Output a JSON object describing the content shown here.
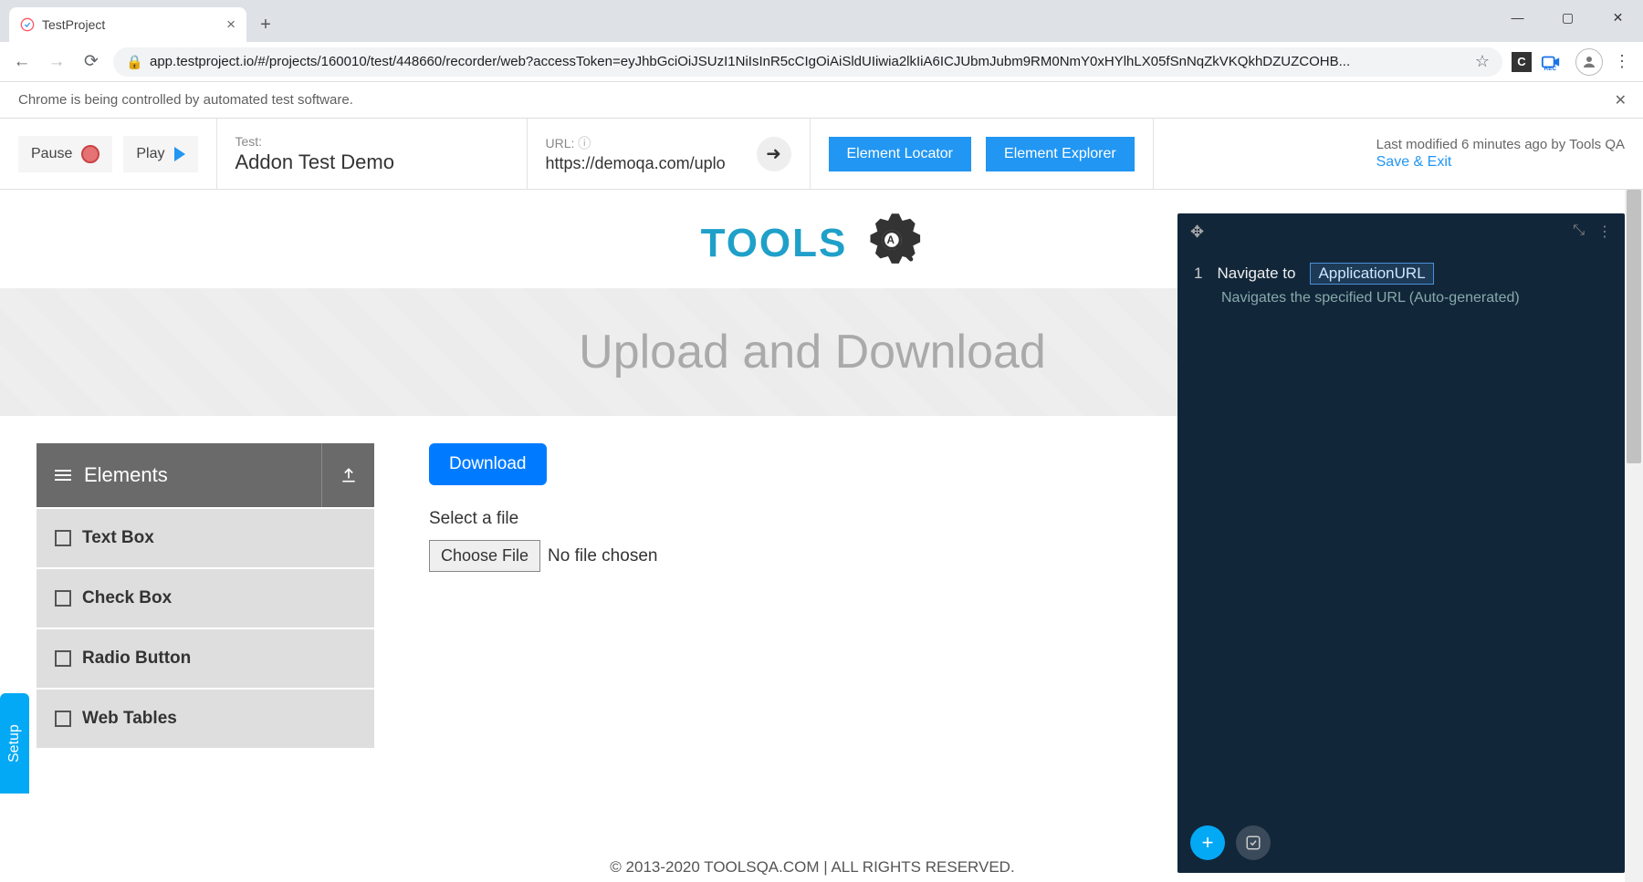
{
  "browser": {
    "tab_title": "TestProject",
    "url": "app.testproject.io/#/projects/160010/test/448660/recorder/web?accessToken=eyJhbGciOiJSUzI1NiIsInR5cCIgOiAiSldUIiwia2lkIiA6ICJUbmJubm9RM0NmY0xHYlhLX05fSnNqZkVKQkhDZUZCOHB...",
    "automation_msg": "Chrome is being controlled by automated test software."
  },
  "toolbar": {
    "pause": "Pause",
    "play": "Play",
    "test_label": "Test:",
    "test_name": "Addon Test Demo",
    "url_label": "URL:",
    "url_value": "https://demoqa.com/uplo",
    "locator_btn": "Element Locator",
    "explorer_btn": "Element Explorer",
    "modified": "Last modified 6 minutes ago by Tools QA",
    "save_exit": "Save & Exit"
  },
  "page": {
    "logo_tools": "TOOLS",
    "banner_title": "Upload and Download",
    "download_btn": "Download",
    "select_label": "Select a file",
    "choose_btn": "Choose File",
    "file_status": "No file chosen",
    "footer": "© 2013-2020 TOOLSQA.COM | ALL RIGHTS RESERVED."
  },
  "sidebar": {
    "header": "Elements",
    "items": [
      "Text Box",
      "Check Box",
      "Radio Button",
      "Web Tables"
    ]
  },
  "setup_tab": "Setup",
  "recorder": {
    "step_num": "1",
    "step_action": "Navigate to",
    "step_param": "ApplicationURL",
    "step_desc": "Navigates the specified URL (Auto-generated)"
  }
}
